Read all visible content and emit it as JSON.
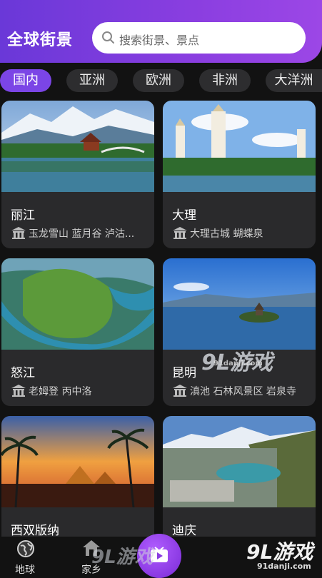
{
  "header": {
    "title": "全球街景",
    "search_placeholder": "搜索街景、景点"
  },
  "tabs": [
    {
      "label": "国内",
      "active": true
    },
    {
      "label": "亚洲",
      "active": false
    },
    {
      "label": "欧洲",
      "active": false
    },
    {
      "label": "非洲",
      "active": false
    },
    {
      "label": "大洋洲",
      "active": false
    }
  ],
  "cards": [
    {
      "name": "丽江",
      "spots": "玉龙雪山  蓝月谷  泸沽..."
    },
    {
      "name": "大理",
      "spots": "大理古城  蝴蝶泉"
    },
    {
      "name": "怒江",
      "spots": "老姆登  丙中洛"
    },
    {
      "name": "昆明",
      "spots": "滇池  石林风景区  岩泉寺"
    },
    {
      "name": "西双版纳",
      "spots": ""
    },
    {
      "name": "迪庆",
      "spots": ""
    }
  ],
  "bottom_nav": {
    "earth_label": "地球",
    "home_label": "家乡"
  },
  "watermarks": {
    "center": "9L游戏",
    "center_url": "91danji.com",
    "corner": "9L游戏",
    "corner_url": "91danji.com"
  },
  "colors": {
    "accent": "#7b45e6",
    "header_gradient_start": "#6a38d8",
    "card_bg": "#2a2a2c",
    "page_bg": "#121212"
  }
}
